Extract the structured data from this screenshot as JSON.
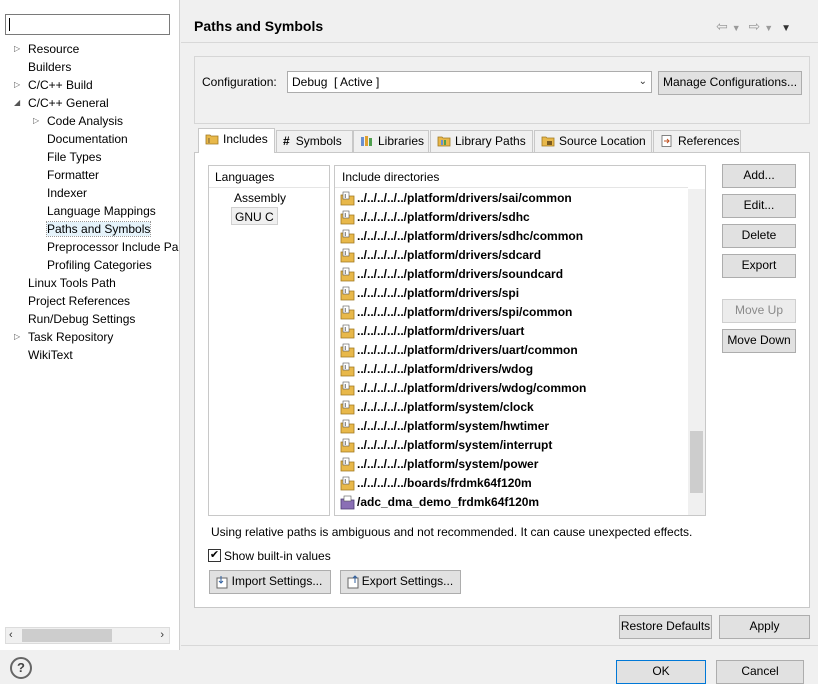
{
  "tree": {
    "filter_value": "",
    "items": [
      {
        "label": "Resource",
        "indent": 0,
        "twisty": "right"
      },
      {
        "label": "Builders",
        "indent": 0,
        "twisty": ""
      },
      {
        "label": "C/C++ Build",
        "indent": 0,
        "twisty": "right"
      },
      {
        "label": "C/C++ General",
        "indent": 0,
        "twisty": "down"
      },
      {
        "label": "Code Analysis",
        "indent": 1,
        "twisty": "right"
      },
      {
        "label": "Documentation",
        "indent": 1,
        "twisty": ""
      },
      {
        "label": "File Types",
        "indent": 1,
        "twisty": ""
      },
      {
        "label": "Formatter",
        "indent": 1,
        "twisty": ""
      },
      {
        "label": "Indexer",
        "indent": 1,
        "twisty": ""
      },
      {
        "label": "Language Mappings",
        "indent": 1,
        "twisty": ""
      },
      {
        "label": "Paths and Symbols",
        "indent": 1,
        "twisty": "",
        "selected": true
      },
      {
        "label": "Preprocessor Include Pa",
        "indent": 1,
        "twisty": ""
      },
      {
        "label": "Profiling Categories",
        "indent": 1,
        "twisty": ""
      },
      {
        "label": "Linux Tools Path",
        "indent": 0,
        "twisty": ""
      },
      {
        "label": "Project References",
        "indent": 0,
        "twisty": ""
      },
      {
        "label": "Run/Debug Settings",
        "indent": 0,
        "twisty": ""
      },
      {
        "label": "Task Repository",
        "indent": 0,
        "twisty": "right"
      },
      {
        "label": "WikiText",
        "indent": 0,
        "twisty": ""
      }
    ]
  },
  "header": {
    "title": "Paths and Symbols",
    "nav_icons": [
      "back-arrow-icon",
      "dropdown-icon",
      "forward-arrow-icon",
      "dropdown-icon",
      "view-menu-icon"
    ]
  },
  "configuration": {
    "label": "Configuration:",
    "value": "Debug  [ Active ]",
    "manage_label": "Manage Configurations..."
  },
  "tabs": [
    {
      "label": "Includes",
      "icon": "includes-folder-icon",
      "active": true
    },
    {
      "label": "Symbols",
      "icon": "hash-icon"
    },
    {
      "label": "Libraries",
      "icon": "libraries-icon"
    },
    {
      "label": "Library Paths",
      "icon": "library-paths-icon"
    },
    {
      "label": "Source Location",
      "icon": "source-folder-icon"
    },
    {
      "label": "References",
      "icon": "references-icon"
    }
  ],
  "languages": {
    "header": "Languages",
    "items": [
      "Assembly",
      "GNU C"
    ],
    "selected": "GNU C"
  },
  "includes": {
    "header": "Include directories",
    "rows": [
      {
        "path": "../../../../../platform/drivers/sai/common",
        "icon": "include-folder-icon"
      },
      {
        "path": "../../../../../platform/drivers/sdhc",
        "icon": "include-folder-icon"
      },
      {
        "path": "../../../../../platform/drivers/sdhc/common",
        "icon": "include-folder-icon"
      },
      {
        "path": "../../../../../platform/drivers/sdcard",
        "icon": "include-folder-icon"
      },
      {
        "path": "../../../../../platform/drivers/soundcard",
        "icon": "include-folder-icon"
      },
      {
        "path": "../../../../../platform/drivers/spi",
        "icon": "include-folder-icon"
      },
      {
        "path": "../../../../../platform/drivers/spi/common",
        "icon": "include-folder-icon"
      },
      {
        "path": "../../../../../platform/drivers/uart",
        "icon": "include-folder-icon"
      },
      {
        "path": "../../../../../platform/drivers/uart/common",
        "icon": "include-folder-icon"
      },
      {
        "path": "../../../../../platform/drivers/wdog",
        "icon": "include-folder-icon"
      },
      {
        "path": "../../../../../platform/drivers/wdog/common",
        "icon": "include-folder-icon"
      },
      {
        "path": "../../../../../platform/system/clock",
        "icon": "include-folder-icon"
      },
      {
        "path": "../../../../../platform/system/hwtimer",
        "icon": "include-folder-icon"
      },
      {
        "path": "../../../../../platform/system/interrupt",
        "icon": "include-folder-icon"
      },
      {
        "path": "../../../../../platform/system/power",
        "icon": "include-folder-icon"
      },
      {
        "path": "../../../../../boards/frdmk64f120m",
        "icon": "include-folder-icon"
      },
      {
        "path": "/adc_dma_demo_frdmk64f120m",
        "icon": "project-icon"
      }
    ]
  },
  "side_buttons": {
    "add": "Add...",
    "edit": "Edit...",
    "delete": "Delete",
    "export": "Export",
    "move_up": "Move Up",
    "move_down": "Move Down"
  },
  "warning": "Using relative paths is ambiguous and not recommended. It can cause unexpected effects.",
  "show_builtin": {
    "label": "Show built-in values",
    "checked": true
  },
  "import_settings": "Import Settings...",
  "export_settings": "Export Settings...",
  "restore_defaults": "Restore Defaults",
  "apply": "Apply",
  "ok": "OK",
  "cancel": "Cancel",
  "colors": {
    "selection": "#e5f3fb",
    "folder": "#e8b84a",
    "project": "#8a6fb5"
  }
}
